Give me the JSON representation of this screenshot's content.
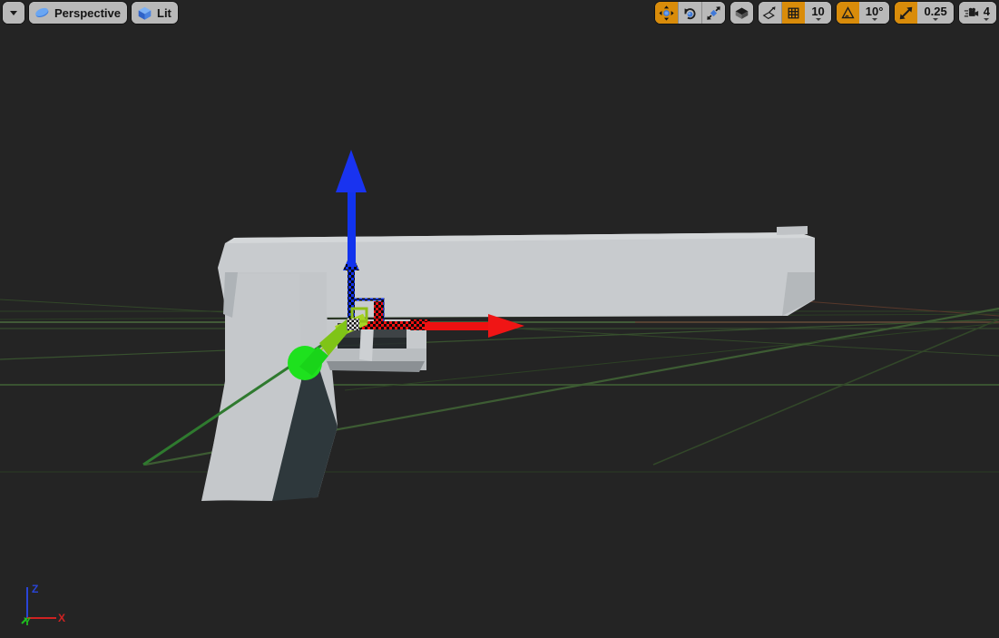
{
  "viewport": {
    "background_color": "#242424",
    "grid_color": "#3f5c33",
    "x_axis_line_color": "#6e3f33",
    "y_axis_line_color": "#4a6b3a"
  },
  "toolbar": {
    "left": {
      "options_dropdown": {
        "name": "viewport-options-dropdown",
        "icon": "chevron-down-icon",
        "label": ""
      },
      "view_type": {
        "label": "Perspective",
        "icon": "perspective-camera-icon"
      },
      "view_mode": {
        "label": "Lit",
        "icon": "lit-cube-icon"
      }
    },
    "right": {
      "transform_tools": [
        {
          "name": "translate",
          "icon": "move-gizmo-icon",
          "active": true
        },
        {
          "name": "rotate",
          "icon": "rotate-gizmo-icon",
          "active": false
        },
        {
          "name": "scale",
          "icon": "scale-gizmo-icon",
          "active": false
        }
      ],
      "coordinate_space": {
        "name": "world-space-toggle",
        "icon": "cube-icon",
        "active": false
      },
      "surface_snap": {
        "name": "surface-snapping-toggle",
        "icon": "surface-snap-icon",
        "active": false
      },
      "grid_snap": {
        "name": "grid-snap-toggle",
        "icon": "grid-icon",
        "active": true
      },
      "grid_size": "10",
      "rotation_snap": {
        "name": "rotation-snap-toggle",
        "icon": "angle-icon",
        "active": true
      },
      "rotation_size": "10°",
      "scale_snap": {
        "name": "scale-snap-toggle",
        "icon": "diagonal-arrow-icon",
        "active": true
      },
      "scale_size": "0.25",
      "camera_speed": {
        "name": "camera-speed",
        "icon": "movie-camera-icon",
        "value": "4"
      }
    }
  },
  "axis_widget": {
    "x": {
      "label": "X",
      "color": "#cf2222"
    },
    "y": {
      "label": "Y",
      "color": "#1fbf1f"
    },
    "z": {
      "label": "Z",
      "color": "#2a45d8"
    }
  },
  "gizmo": {
    "type": "translate",
    "x_axis_color": "#ee1111",
    "y_axis_color": "#11dd11",
    "z_axis_color": "#1133ee"
  },
  "mesh": {
    "name": "pistol-static-mesh",
    "fill": "#c2c5c8",
    "shade": "#9aa0a4",
    "dark": "#2c3539"
  }
}
